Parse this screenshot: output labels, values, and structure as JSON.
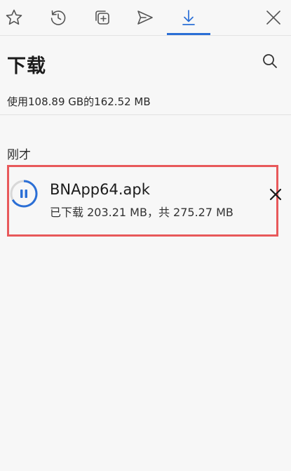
{
  "toolbar": {
    "tabs": [
      {
        "name": "favorites",
        "icon": "star-icon"
      },
      {
        "name": "history",
        "icon": "history-icon"
      },
      {
        "name": "collections",
        "icon": "collections-icon"
      },
      {
        "name": "share",
        "icon": "send-icon"
      },
      {
        "name": "downloads",
        "icon": "download-icon",
        "active": true
      }
    ],
    "close_icon": "close-icon"
  },
  "header": {
    "title": "下载",
    "search_icon": "search-icon"
  },
  "storage_usage": "使用108.89 GB的162.52 MB",
  "sections": [
    {
      "label": "刚才",
      "items": [
        {
          "file_name": "BNApp64.apk",
          "status": "已下载 203.21 MB，共 275.27 MB",
          "state": "paused-toggle",
          "action_icon": "pause-icon",
          "remove_icon": "close-icon"
        }
      ]
    }
  ],
  "colors": {
    "accent": "#2b6fd6",
    "highlight_border": "#e8595b",
    "background": "#f7f7f7"
  }
}
